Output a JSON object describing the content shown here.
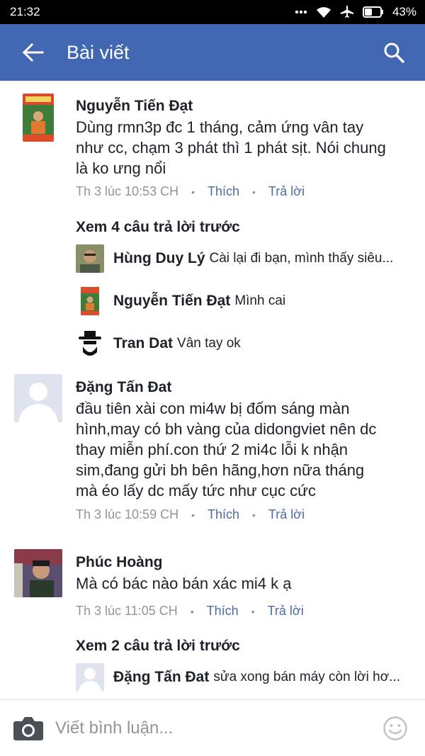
{
  "status_bar": {
    "time": "21:32",
    "icons": [
      "more-dots-icon",
      "wifi-icon",
      "airplane-icon",
      "battery-icon"
    ],
    "battery": "43%",
    "battery_level": 0.43
  },
  "app_bar": {
    "title": "Bài viết",
    "color": "#4267b2",
    "back_icon": "arrow-left-icon",
    "search_icon": "search-icon"
  },
  "comments": [
    {
      "name": "Nguyễn Tiến Đạt",
      "text": "Dùng rmn3p đc 1 tháng, cảm ứng vân tay như cc, chạm 3 phát thì 1 phát sịt. Nói chung là ko ưng nổi",
      "time": "Th 3 lúc 10:53 CH",
      "like": "Thích",
      "reply": "Trả lời",
      "more_replies": "Xem 4 câu trả lời trước",
      "replies": [
        {
          "name": "Hùng Duy Lý",
          "text": "Cài lại đi bạn, mình thấy siêu..."
        },
        {
          "name": "Nguyễn Tiến Đạt",
          "text": "Mình cai"
        },
        {
          "name": "Tran Dat",
          "text": "Vân tay ok"
        }
      ]
    },
    {
      "name": "Đặng Tấn Đat",
      "text": "đầu tiên xài con mi4w bị đốm sáng màn hình,may có bh vàng của didongviet nên dc thay miễn phí.con thứ 2 mi4c lỗi k nhận sim,đang gửi bh bên hãng,hơn nữa tháng mà éo lấy dc mấy tức như cục cức",
      "time": "Th 3 lúc 10:59 CH",
      "like": "Thích",
      "reply": "Trả lời"
    },
    {
      "name": "Phúc Hoàng",
      "text": "Mà có bác nào bán xác mi4 k ạ",
      "time": "Th 3 lúc 11:05 CH",
      "like": "Thích",
      "reply": "Trả lời",
      "more_replies": "Xem 2 câu trả lời trước",
      "replies": [
        {
          "name": "Đặng Tấn Đat",
          "text": "sửa xong bán máy còn lời hơ..."
        }
      ]
    }
  ],
  "composer": {
    "placeholder": "Viết bình luận...",
    "camera_icon": "camera-icon",
    "emoji_icon": "emoji-smile-icon"
  }
}
